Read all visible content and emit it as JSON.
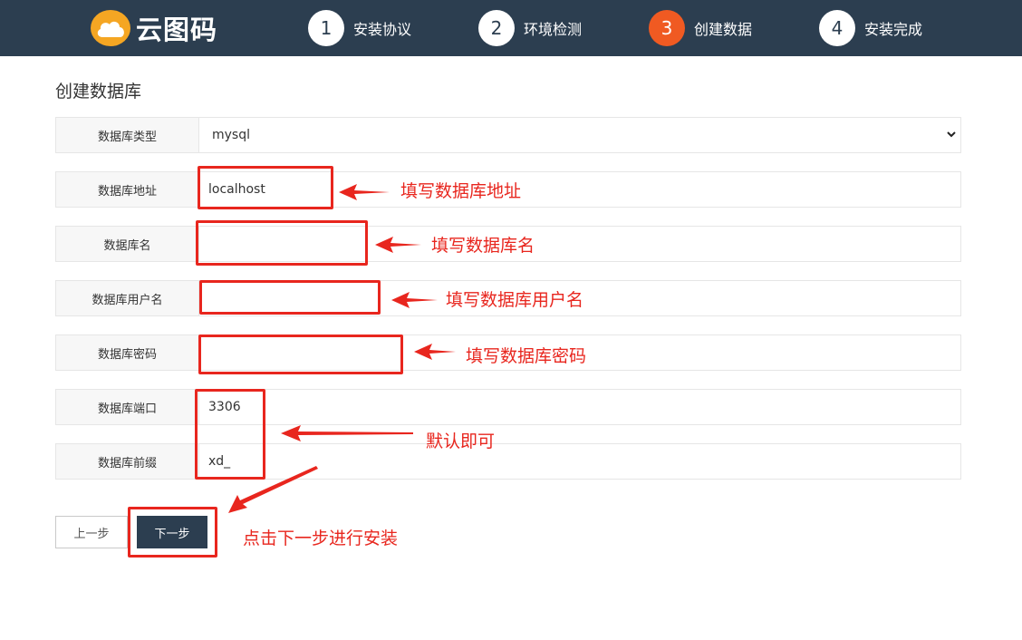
{
  "header": {
    "logo_text": "云图码",
    "steps": [
      {
        "num": "1",
        "label": "安装协议",
        "active": false
      },
      {
        "num": "2",
        "label": "环境检测",
        "active": false
      },
      {
        "num": "3",
        "label": "创建数据",
        "active": true
      },
      {
        "num": "4",
        "label": "安装完成",
        "active": false
      }
    ]
  },
  "page": {
    "title": "创建数据库"
  },
  "form": {
    "db_type": {
      "label": "数据库类型",
      "value": "mysql"
    },
    "db_host": {
      "label": "数据库地址",
      "value": "localhost"
    },
    "db_name": {
      "label": "数据库名",
      "value": ""
    },
    "db_user": {
      "label": "数据库用户名",
      "value": ""
    },
    "db_password": {
      "label": "数据库密码",
      "value": ""
    },
    "db_port": {
      "label": "数据库端口",
      "value": "3306"
    },
    "db_prefix": {
      "label": "数据库前缀",
      "value": "xd_"
    }
  },
  "annotations": {
    "host": "填写数据库地址",
    "name": "填写数据库名",
    "user": "填写数据库用户名",
    "password": "填写数据库密码",
    "defaults": "默认即可",
    "next": "点击下一步进行安装"
  },
  "buttons": {
    "prev": "上一步",
    "next": "下一步"
  },
  "colors": {
    "header_bg": "#2c3e50",
    "active_step": "#f05a22",
    "annotation_red": "#e8261e",
    "logo_orange": "#f5a623"
  },
  "icons": {
    "logo": "cloud-icon",
    "select": "chevron-down-icon",
    "annotation_arrow": "arrow-left-icon"
  }
}
